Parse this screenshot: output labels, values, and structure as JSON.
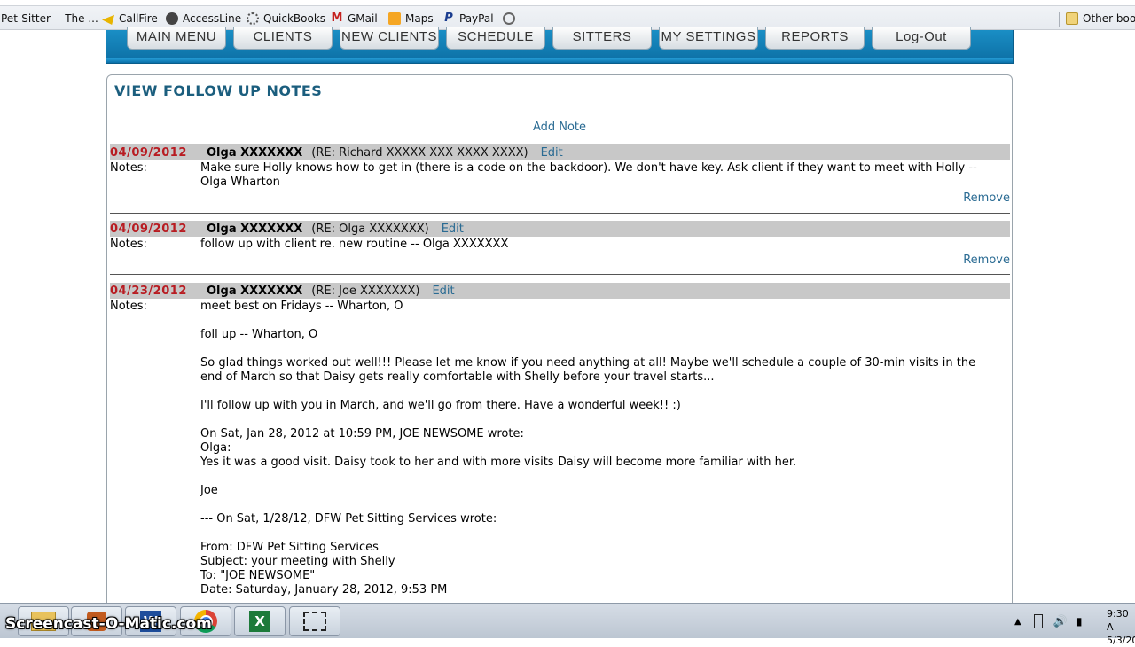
{
  "bookmarks": {
    "items": [
      {
        "label": "Pet-Sitter -- The ...",
        "icon": "page-icon",
        "color": "#ffffff"
      },
      {
        "label": "CallFire",
        "icon": "callfire-icon",
        "color": "#e8b400"
      },
      {
        "label": "AccessLine",
        "icon": "accessline-icon",
        "color": "#333333"
      },
      {
        "label": "QuickBooks",
        "icon": "quickbooks-icon",
        "color": "#2ca01c"
      },
      {
        "label": "GMail",
        "icon": "gmail-icon",
        "color": "#c5221f"
      },
      {
        "label": "Maps",
        "icon": "maps-icon",
        "color": "#f5a623"
      },
      {
        "label": "PayPal",
        "icon": "paypal-icon",
        "color": "#1b3d8f"
      }
    ],
    "other": "Other book"
  },
  "nav": {
    "items": [
      "MAIN MENU",
      "CLIENTS",
      "NEW CLIENTS",
      "SCHEDULE",
      "SITTERS",
      "MY SETTINGS",
      "REPORTS",
      "Log-Out"
    ]
  },
  "page": {
    "title": "VIEW FOLLOW UP NOTES",
    "add_note": "Add Note",
    "notes_label": "Notes:",
    "edit_label": "Edit",
    "remove_label": "Remove"
  },
  "notes": [
    {
      "date": "04/09/2012",
      "author": "Olga XXXXXXX",
      "re": "(RE: Richard XXXXX XXX XXXX XXXX)",
      "text": "Make sure Holly knows how to get in (there is a code on the backdoor). We don't have key. Ask client if they want to meet with Holly --\nOlga Wharton"
    },
    {
      "date": "04/09/2012",
      "author": "Olga XXXXXXX",
      "re": "(RE: Olga XXXXXXX)",
      "text": "follow up with client re. new routine -- Olga XXXXXXX"
    },
    {
      "date": "04/23/2012",
      "author": "Olga XXXXXXX",
      "re": "(RE: Joe XXXXXXX)",
      "text": "meet best on Fridays -- Wharton, O\n\nfoll up -- Wharton, O\n\nSo glad things worked out well!!! Please let me know if you need anything at all! Maybe we'll schedule a couple of 30-min visits in the\nend of March so that Daisy gets really comfortable with Shelly before your travel starts...\n\nI'll follow up with you in March, and we'll go from there. Have a wonderful week!! :)\n\nOn Sat, Jan 28, 2012 at 10:59 PM, JOE NEWSOME wrote:\nOlga:\nYes it was a good visit. Daisy took to her and with more visits Daisy will become more familiar with her.\n\nJoe\n\n--- On Sat, 1/28/12, DFW Pet Sitting Services wrote:\n\nFrom: DFW Pet Sitting Services\nSubject: your meeting with Shelly\nTo: \"JOE NEWSOME\"\nDate: Saturday, January 28, 2012, 9:53 PM"
    }
  ],
  "taskbar": {
    "watermark": "Screencast-O-Matic.com",
    "time": "9:30 A",
    "date": "5/3/20"
  }
}
